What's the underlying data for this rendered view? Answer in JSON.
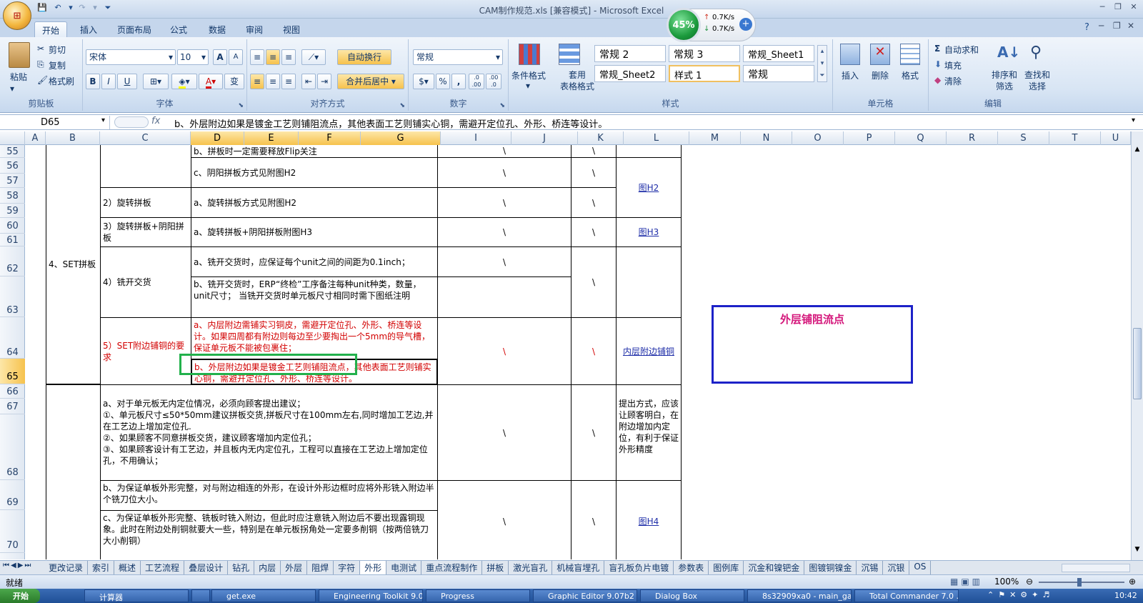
{
  "window": {
    "title": "CAM制作规范.xls  [兼容模式] - Microsoft Excel"
  },
  "tabs": [
    "开始",
    "插入",
    "页面布局",
    "公式",
    "数据",
    "审阅",
    "视图"
  ],
  "ribbon": {
    "clipboard": {
      "paste": "粘贴",
      "cut": "剪切",
      "copy": "复制",
      "format_painter": "格式刷",
      "group": "剪贴板"
    },
    "font": {
      "name": "宋体",
      "size": "10",
      "group": "字体",
      "bold": "B",
      "italic": "I",
      "underline": "U",
      "grow": "A",
      "shrink": "A",
      "font_color": "A",
      "phonetic": "变"
    },
    "alignment": {
      "wrap": "自动换行",
      "merge": "合并后居中",
      "group": "对齐方式"
    },
    "number": {
      "format": "常规",
      "percent": "%",
      "comma": ",",
      "inc_dec": ".0 .00",
      "dec_dec": ".00 .0",
      "group": "数字"
    },
    "styles": {
      "cond_format": "条件格式",
      "table_format": "套用\n表格格式",
      "style_items": [
        "常规 2",
        "常规 3",
        "常规_Sheet1",
        "常规_Sheet2",
        "样式 1",
        "常规"
      ],
      "group": "样式"
    },
    "cells": {
      "insert": "插入",
      "delete": "删除",
      "format": "格式",
      "group": "单元格"
    },
    "editing": {
      "autosum": "自动求和",
      "fill": "填充",
      "clear": "清除",
      "sort": "排序和\n筛选",
      "find": "查找和\n选择",
      "group": "编辑"
    }
  },
  "net": {
    "percent": "45%",
    "up": "0.7K/s",
    "down": "0.7K/s"
  },
  "formula": {
    "cell": "D65",
    "fx": "fx",
    "content": "b、外层附边如果是镀金工艺则铺阻流点，其他表面工艺则铺实心铜，需避开定位孔、外形、桥连等设计。"
  },
  "columns": [
    "A",
    "B",
    "C",
    "D",
    "E",
    "F",
    "G",
    "I",
    "J",
    "K",
    "L",
    "M",
    "N",
    "O",
    "P",
    "Q",
    "R",
    "S",
    "T",
    "U"
  ],
  "rows": [
    "55",
    "56",
    "57",
    "58",
    "59",
    "60",
    "61",
    "62",
    "63",
    "64",
    "65",
    "66",
    "67",
    "68",
    "69",
    "70"
  ],
  "cells": {
    "r55": "b、拼板时一定需要释放Flip关注",
    "r56c": "c、阴阳拼板方式见附图H2",
    "r58c": "2）旋转拼板",
    "r58d": "a、旋转拼板方式见附图H2",
    "r60c": "3）旋转拼板+阴阳拼板",
    "r60d": "a、旋转拼板+阴阳拼板附图H3",
    "set": "4、SET拼板",
    "r62c": "4）铣开交货",
    "r62d": "a、铣开交货时，应保证每个unit之间的间距为0.1inch；",
    "r63d": "b、铣开交货时，ERP“终检”工序备注每种unit种类，数量，unit尺寸；  当铣开交货时单元板尺寸相同时需下图纸注明",
    "r64c": "5）SET附边铺铜的要求",
    "r64d": "a、内层附边需铺实习铜皮，需避开定位孔、外形、桥连等设计。如果四周都有附边则每边至少要掏出一个5mm的导气槽，保证单元板不能被包裹住；",
    "r65d": "b、外层附边如果是镀金工艺则铺阻流点，其他表面工艺则铺实心铜，需避开定位孔、外形、桥连等设计。",
    "r66c": "a、对于单元板无内定位情况，必须向顾客提出建议；\n①、单元板尺寸≤50*50mm建议拼板交货,拼板尺寸在100mm左右,同时增加工艺边,并在工艺边上增加定位孔.\n②、如果顾客不同意拼板交货，建议顾客增加内定位孔；\n③、如果顾客设计有工艺边，并且板内无内定位孔，工程可以直接在工艺边上增加定位孔，不用确认；",
    "r66l": "提出方式，应该让顾客明白，在附边增加内定位，有利于保证外形精度",
    "r69c": "b、为保证单板外形完整，对与附边相连的外形，在设计外形边框时应将外形铣入附边半个铣刀位大小。",
    "r70c": "c、为保证单板外形完整、铣板时铣入附边，但此时应注意铣入附边后不要出现露铜现象。此时在附边处削铜就要大一些，特别是在单元板拐角处一定要多削铜（按两倍铣刀大小削铜）",
    "bs": "\\",
    "h2": "图H2",
    "h3": "图H3",
    "h4": "图H4",
    "inner_link": "内层附边铺铜",
    "box_title": "外层铺阻流点"
  },
  "sheets": [
    "更改记录",
    "索引",
    "概述",
    "工艺流程",
    "叠层设计",
    "钻孔",
    "内层",
    "外层",
    "阻焊",
    "字符",
    "外形",
    "电测试",
    "重点流程制作",
    "拼板",
    "激光盲孔",
    "机械盲埋孔",
    "盲孔板负片电镀",
    "参数表",
    "图例库",
    "沉金和镍钯金",
    "图镀铜镍金",
    "沉锡",
    "沉银",
    "OS"
  ],
  "status": {
    "ready": "就绪",
    "zoom": "100%"
  },
  "taskbar": {
    "start": "开始",
    "items": [
      "计算器",
      "",
      "get.exe",
      "Engineering Toolkit 9.0...",
      "Progress",
      "Graphic Editor 9.07b2 (...",
      "Dialog Box",
      "8s32909xa0 - main_ga",
      "Total Commander 7.0 ..."
    ],
    "time": "10:42"
  },
  "colors": {
    "accent": "#1b9a3c",
    "red_text": "#d20000",
    "box_border": "#1d22c8",
    "box_title": "#d4157a",
    "selection": "#22b14c"
  }
}
